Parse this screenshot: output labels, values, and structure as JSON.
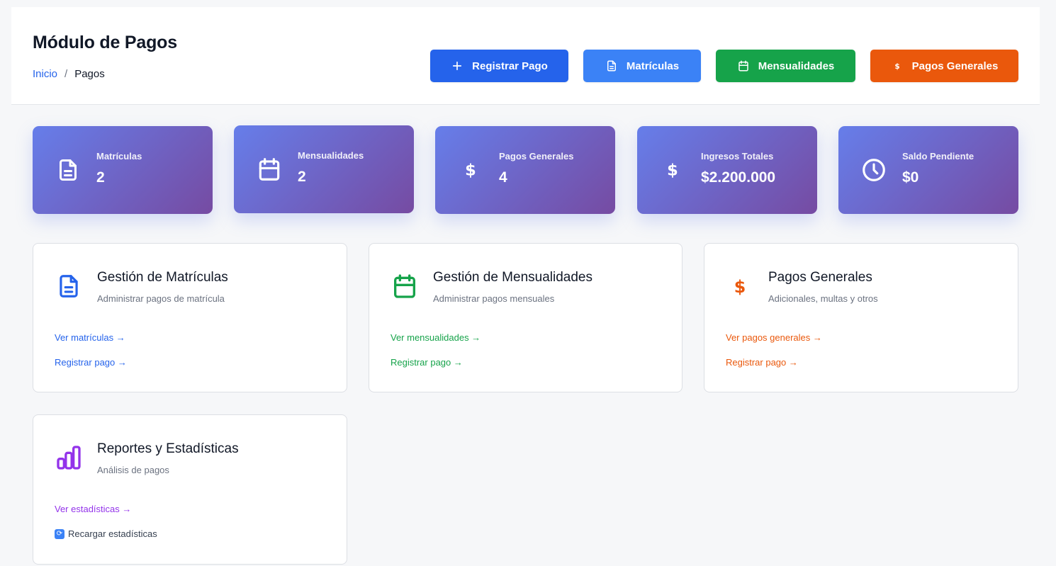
{
  "header": {
    "title": "Módulo de Pagos",
    "breadcrumb": {
      "home": "Inicio",
      "separator": "/",
      "current": "Pagos"
    },
    "buttons": {
      "registrar": "Registrar Pago",
      "matriculas": "Matrículas",
      "mensualidades": "Mensualidades",
      "pagos_generales": "Pagos Generales"
    }
  },
  "stats": [
    {
      "label": "Matrículas",
      "value": "2",
      "icon": "document-icon"
    },
    {
      "label": "Mensualidades",
      "value": "2",
      "icon": "calendar-icon"
    },
    {
      "label": "Pagos Generales",
      "value": "4",
      "icon": "dollar-icon"
    },
    {
      "label": "Ingresos Totales",
      "value": "$2.200.000",
      "icon": "dollar-icon"
    },
    {
      "label": "Saldo Pendiente",
      "value": "$0",
      "icon": "clock-icon"
    }
  ],
  "cards": [
    {
      "title": "Gestión de Matrículas",
      "subtitle": "Administrar pagos de matrícula",
      "link1": "Ver matrículas →",
      "link2": "Registrar pago →"
    },
    {
      "title": "Gestión de Mensualidades",
      "subtitle": "Administrar pagos mensuales",
      "link1": "Ver mensualidades →",
      "link2": "Registrar pago →"
    },
    {
      "title": "Pagos Generales",
      "subtitle": "Adicionales, multas y otros",
      "link1": "Ver pagos generales →",
      "link2": "Registrar pago →"
    },
    {
      "title": "Reportes y Estadísticas",
      "subtitle": "Análisis de pagos",
      "link1": "Ver estadísticas →",
      "link2": "Recargar estadísticas"
    }
  ],
  "colors": {
    "blue": "#2563eb",
    "light_blue": "#3b82f6",
    "green": "#16a34a",
    "orange": "#ea580c",
    "purple": "#9333ea",
    "gradient_start": "#667eea",
    "gradient_end": "#764ba2"
  }
}
